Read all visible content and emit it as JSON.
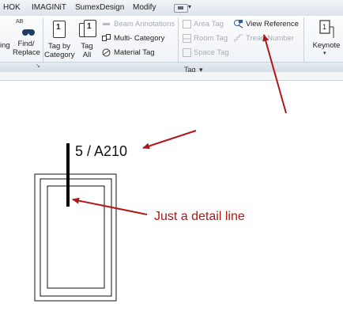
{
  "menu": {
    "items": [
      "HOK",
      "IMAGINiT",
      "SumexDesign",
      "Modify"
    ]
  },
  "ribbon": {
    "left_cut_label": "ing",
    "find_replace": {
      "line1": "Find/",
      "line2": "Replace"
    },
    "tag_by_category": {
      "line1": "Tag by",
      "line2": "Category"
    },
    "tag_all": {
      "line1": "Tag",
      "line2": "All"
    },
    "beam_annotations": "Beam  Annotations",
    "multi_category": "Multi- Category",
    "material_tag": "Material  Tag",
    "area_tag": "Area  Tag",
    "room_tag": "Room  Tag",
    "space_tag": "Space  Tag",
    "view_reference": "View  Reference",
    "tread_number": "Tread  Number",
    "keynote": "Keynote",
    "group_title": "Tag",
    "group_title_caret": "▾",
    "launcher_glyph": "↘",
    "find_replace_icon_text": "AB"
  },
  "drawing": {
    "detail_tag": "5 / A210",
    "annotation": "Just a detail line"
  },
  "colors": {
    "arrow": "#b01818",
    "ribbon_bg": "#eef2f6",
    "ribbon_disabled_text": "#a6acb4",
    "annotation_text": "#b01818"
  }
}
